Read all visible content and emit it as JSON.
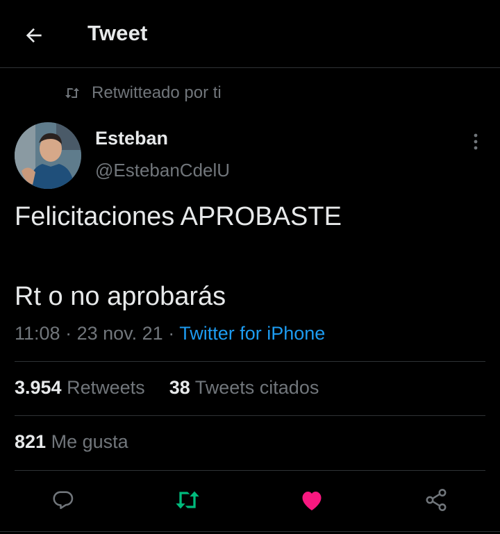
{
  "header": {
    "title": "Tweet",
    "back_icon": "arrow-left-icon"
  },
  "retweet_context": {
    "icon": "retweet-icon",
    "label": "Retwitteado por ti"
  },
  "author": {
    "name": "Esteban",
    "handle": "@EstebanCdelU",
    "avatar_icon": "avatar-photo"
  },
  "tweet": {
    "lines": [
      "Felicitaciones APROBASTE",
      "Rt o no aprobarás"
    ],
    "time": "11:08",
    "separator": "·",
    "date": "23 nov. 21",
    "source": "Twitter for iPhone"
  },
  "stats": {
    "retweets_count": "3.954",
    "retweets_label": "Retweets",
    "quotes_count": "38",
    "quotes_label": "Tweets citados",
    "likes_count": "821",
    "likes_label": "Me gusta"
  },
  "actions": {
    "reply_icon": "reply-bubble-icon",
    "retweet_icon": "retweet-icon",
    "like_icon": "heart-icon",
    "share_icon": "share-icon"
  },
  "colors": {
    "background": "#000000",
    "text_primary": "#e7e9ea",
    "text_secondary": "#71767b",
    "link": "#1d9bf0",
    "retweet_active": "#00ba7c",
    "like_active": "#f91880",
    "divider": "#2f3336"
  }
}
